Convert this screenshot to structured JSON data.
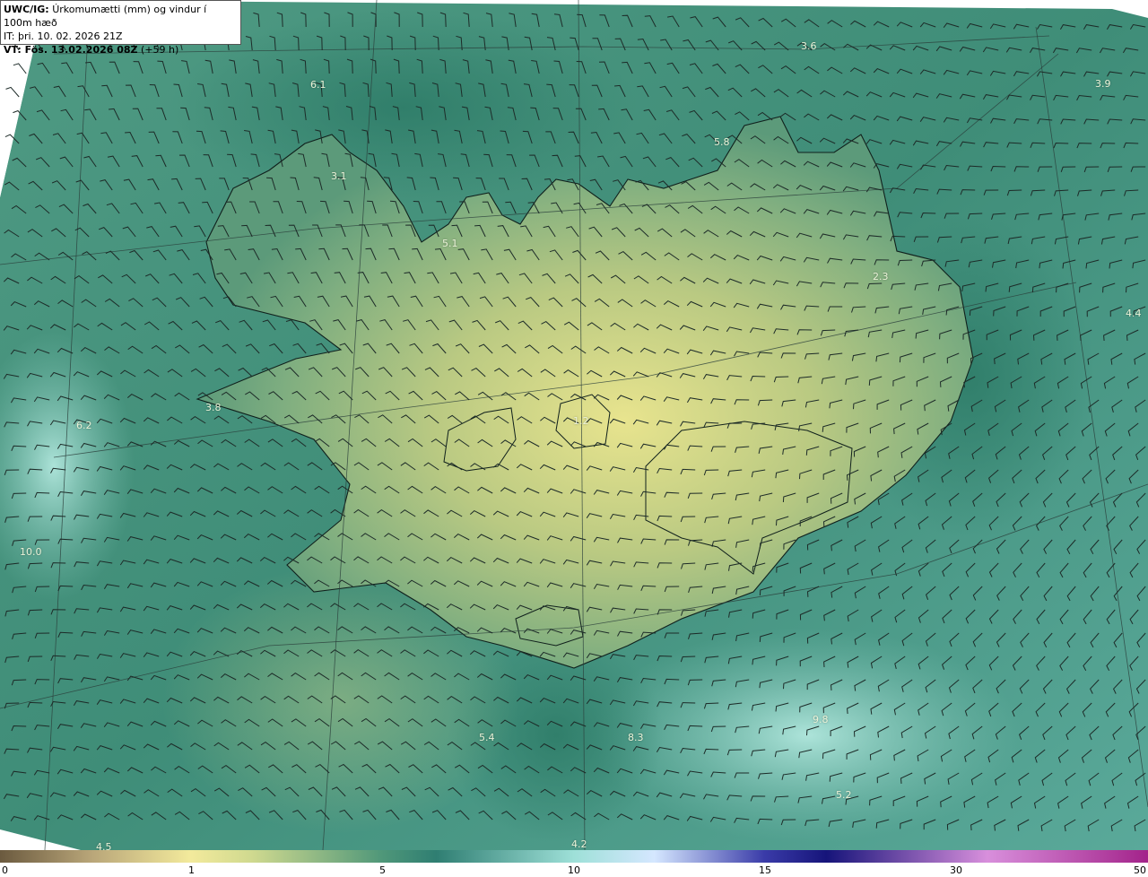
{
  "title": {
    "line1_bold": "UWC/IG:",
    "line1_text": "Úrkomumætti (mm) og vindur í 100m hæð",
    "line2": "IT: þri. 10. 02. 2026 21Z",
    "line3_bold": "VT: Fös. 13.02.2026 08Z",
    "line3_text": "(+59 h)"
  },
  "values": [
    {
      "id": "v1",
      "text": "3.6"
    },
    {
      "id": "v2",
      "text": "6.1"
    },
    {
      "id": "v3",
      "text": "3.9"
    },
    {
      "id": "v4",
      "text": "5.8"
    },
    {
      "id": "v5",
      "text": "3.1"
    },
    {
      "id": "v6",
      "text": "5.1"
    },
    {
      "id": "v7",
      "text": "2.3"
    },
    {
      "id": "v8",
      "text": "4.4"
    },
    {
      "id": "v9",
      "text": "3.8"
    },
    {
      "id": "v10",
      "text": "1.2"
    },
    {
      "id": "v11",
      "text": "6.2"
    },
    {
      "id": "v12",
      "text": "5.4"
    },
    {
      "id": "v13",
      "text": "8.3"
    },
    {
      "id": "v14",
      "text": "9.8"
    },
    {
      "id": "v15",
      "text": "5.2"
    },
    {
      "id": "v16",
      "text": "4.5"
    },
    {
      "id": "v17",
      "text": "4.2"
    },
    {
      "id": "v18",
      "text": "10.0"
    }
  ],
  "legend": {
    "ticks": [
      "0",
      "1",
      "5",
      "10",
      "15",
      "30",
      "50"
    ],
    "colors": [
      "#6b5a3f",
      "#f3ea9c",
      "#4f9779",
      "#9ee0d8",
      "#3a3ba8",
      "#d88fdc",
      "#a3238a"
    ]
  }
}
